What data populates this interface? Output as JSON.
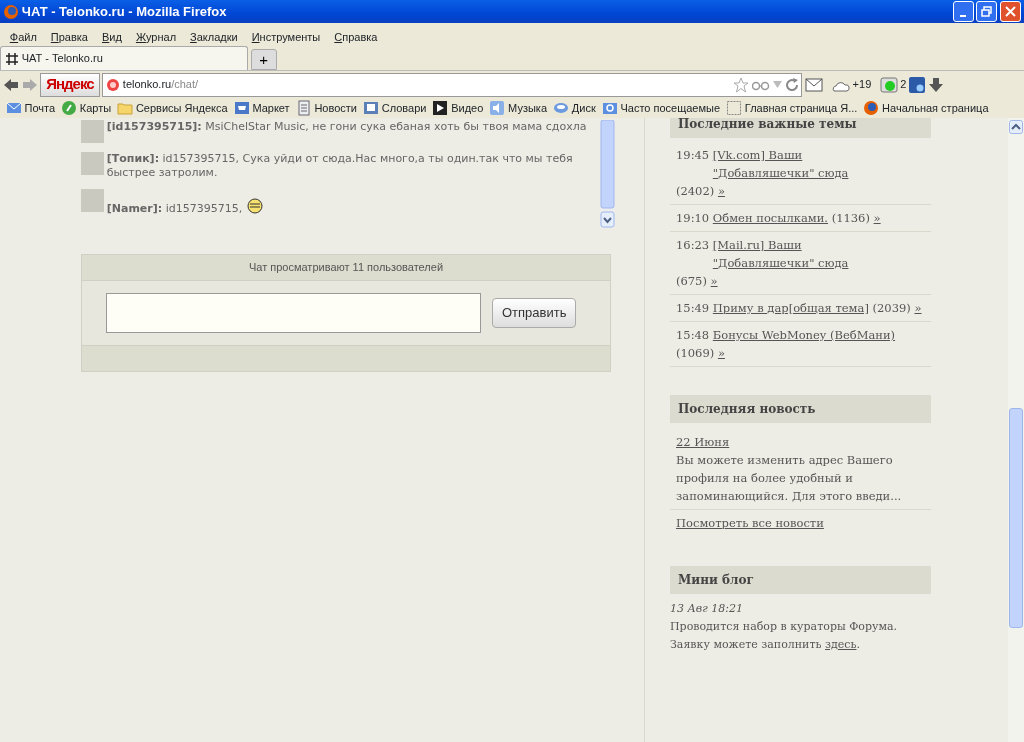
{
  "window": {
    "title": "ЧАТ - Telonko.ru - Mozilla Firefox"
  },
  "menu": [
    "Файл",
    "Правка",
    "Вид",
    "Журнал",
    "Закладки",
    "Инструменты",
    "Справка"
  ],
  "tabs": [
    {
      "label": "ЧАТ - Telonko.ru",
      "selected": true
    }
  ],
  "new_tab": "+",
  "address": {
    "brand": "Яндекс",
    "host": "telonko.ru",
    "path": "/chat/"
  },
  "toolbar": {
    "weather": "+19",
    "badge": "2"
  },
  "bookmarks": [
    {
      "label": "Почта",
      "kind": "mail"
    },
    {
      "label": "Карты",
      "kind": "map"
    },
    {
      "label": "Сервисы Яндекса",
      "kind": "folder"
    },
    {
      "label": "Маркет",
      "kind": "cart"
    },
    {
      "label": "Новости",
      "kind": "page"
    },
    {
      "label": "Словари",
      "kind": "book"
    },
    {
      "label": "Видео",
      "kind": "play"
    },
    {
      "label": "Музыка",
      "kind": "sound"
    },
    {
      "label": "Диск",
      "kind": "disk"
    },
    {
      "label": "Часто посещаемые",
      "kind": "search"
    },
    {
      "label": "Главная страница Я...",
      "kind": "blank"
    },
    {
      "label": "Начальная страница",
      "kind": "globe"
    }
  ],
  "chat": {
    "messages": [
      {
        "author": "[id157395715]:",
        "text": "MsiChelStar Music, не гони сука ебаная хоть бы твоя мама сдохла",
        "smiley": false
      },
      {
        "author": "[Топик]:",
        "text": "id157395715, Сука уйди от сюда.Нас много,а ты один.так что мы тебя быстрее затролим.",
        "smiley": false
      },
      {
        "author": "[Namer]:",
        "text": "id157395715,",
        "smiley": true
      }
    ],
    "viewers": "Чат просматривают 11 пользователей",
    "send": "Отправить"
  },
  "topics": {
    "title": "Последние важные темы",
    "items": [
      {
        "time": "19:45",
        "title": "[Vk.com] Ваши \"Добавляшечки\" сюда",
        "count": "(2402)",
        "more": "»"
      },
      {
        "time": "19:10",
        "title": "Обмен посылками.",
        "count": "(1136)",
        "more": "»"
      },
      {
        "time": "16:23",
        "title": "[Mail.ru] Ваши \"Добавляшечки\" сюда",
        "count": "(675)",
        "more": "»"
      },
      {
        "time": "15:49",
        "title": "Приму в дар[общая тема]",
        "count": "(2039)",
        "more": "»"
      },
      {
        "time": "15:48",
        "title": "Бонусы WebMoney (ВебМани)",
        "count": "(1069)",
        "more": "»"
      }
    ]
  },
  "news": {
    "title": "Последняя новость",
    "date": "22 Июня",
    "text": "Вы можете изменить адрес Вашего профиля на более удобный и запоминающийся. Для этого введи...",
    "all": "Посмотреть все новости"
  },
  "blog": {
    "title": "Мини блог",
    "date": "13 Авг 18:21",
    "lines": [
      "Проводится набор в кураторы Форума."
    ],
    "text": "Заявку можете заполнить",
    "link": "здесь",
    "after": "."
  }
}
